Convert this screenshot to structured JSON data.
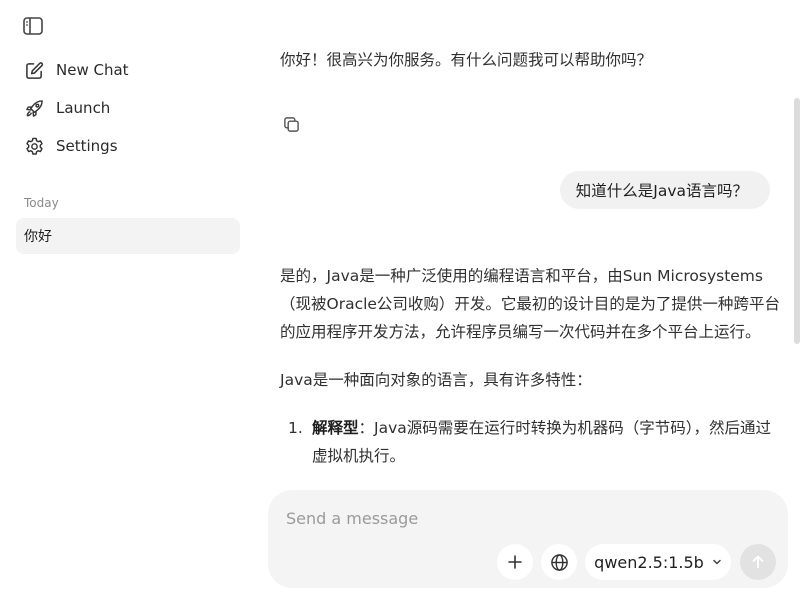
{
  "sidebar": {
    "items": [
      {
        "label": "New Chat",
        "icon": "edit-icon"
      },
      {
        "label": "Launch",
        "icon": "rocket-icon"
      },
      {
        "label": "Settings",
        "icon": "gear-icon"
      }
    ],
    "section_label": "Today",
    "history": [
      {
        "label": "你好"
      }
    ]
  },
  "chat": {
    "assistant_greeting": "你好！很高兴为你服务。有什么问题我可以帮助你吗？",
    "user_message": "知道什么是Java语言吗？",
    "assistant_answer": {
      "paragraph1": "是的，Java是一种广泛使用的编程语言和平台，由Sun Microsystems（现被Oracle公司收购）开发。它最初的设计目的是为了提供一种跨平台的应用程序开发方法，允许程序员编写一次代码并在多个平台上运行。",
      "paragraph2": "Java是一种面向对象的语言，具有许多特性：",
      "list": [
        {
          "num": "1.",
          "title": "解释型",
          "text": "：Java源码需要在运行时转换为机器码（字节码），然后通过虚拟机执行。"
        }
      ]
    }
  },
  "composer": {
    "placeholder": "Send a message",
    "model": "qwen2.5:1.5b"
  },
  "colors": {
    "sidebar_active_bg": "#f3f3f3",
    "bubble_bg": "#f1f1f1",
    "composer_bg": "#f4f4f4",
    "send_disabled": "#e2e2e2"
  }
}
